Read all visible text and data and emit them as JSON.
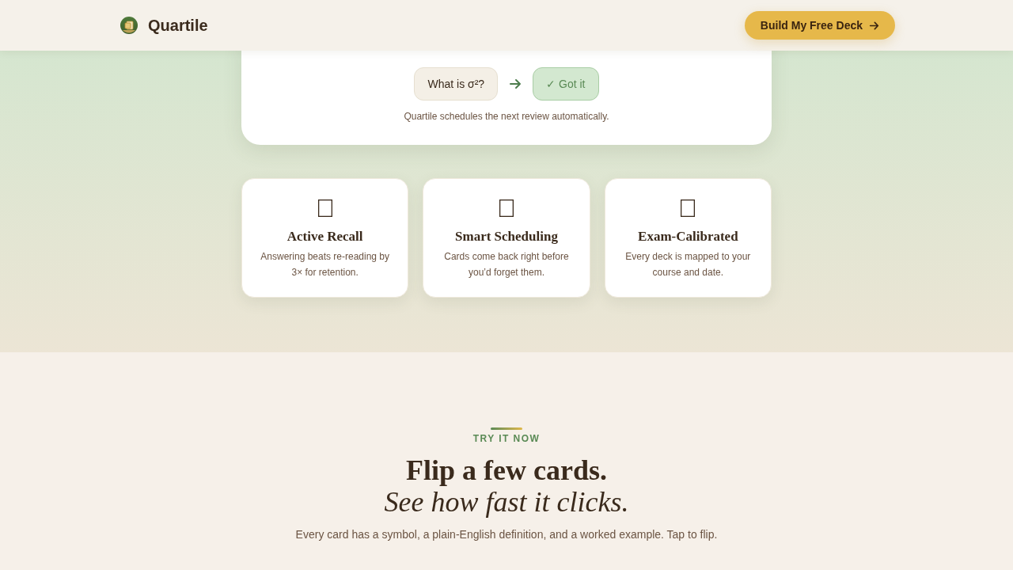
{
  "header": {
    "brand": "Quartile",
    "cta": {
      "label": "Build My Free Deck"
    }
  },
  "hero_card": {
    "steps": [
      {
        "kind": "question",
        "label": "What is σ²?"
      },
      {
        "kind": "answer",
        "label": "✓ Got it"
      }
    ],
    "caption": "Quartile schedules the next review automatically."
  },
  "features": [
    {
      "title": "Active Recall",
      "description": "Answering beats re-reading by 3× for retention."
    },
    {
      "title": "Smart Scheduling",
      "description": "Cards come back right before you’d forget them."
    },
    {
      "title": "Exam-Calibrated",
      "description": "Every deck is mapped to your course and date."
    }
  ],
  "try_section": {
    "eyebrow": "TRY IT NOW",
    "heading": "Flip a few cards.",
    "subheading": "See how fast it clicks.",
    "description": "Every card has a symbol, a plain-English definition, and a worked example. Tap to flip."
  }
}
